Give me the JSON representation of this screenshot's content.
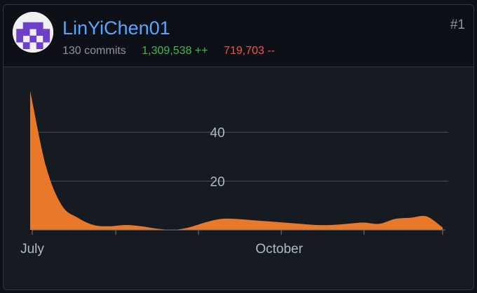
{
  "user": {
    "login": "LinYiChen01",
    "commits_text": "130 commits",
    "additions_text": "1,309,538 ++",
    "deletions_text": "719,703 --",
    "rank": "#1"
  },
  "colors": {
    "link": "#58a6ff",
    "additions": "#3fb950",
    "deletions": "#f85149",
    "area": "#e8782a",
    "avatar": "#6e40c9"
  },
  "chart_data": {
    "type": "area",
    "x_tick_labels": [
      "July",
      "October"
    ],
    "y_tick_labels": [
      "20",
      "40"
    ],
    "ylim": [
      0,
      60
    ],
    "series": [
      {
        "values": [
          57,
          26,
          10,
          5,
          2,
          1.5,
          2,
          1.5,
          0.5,
          0,
          1,
          3,
          4.5,
          4.5,
          4,
          3.5,
          3,
          2.5,
          2,
          2,
          2.5,
          3,
          2.5,
          4.5,
          5,
          5.5,
          1
        ]
      }
    ]
  }
}
